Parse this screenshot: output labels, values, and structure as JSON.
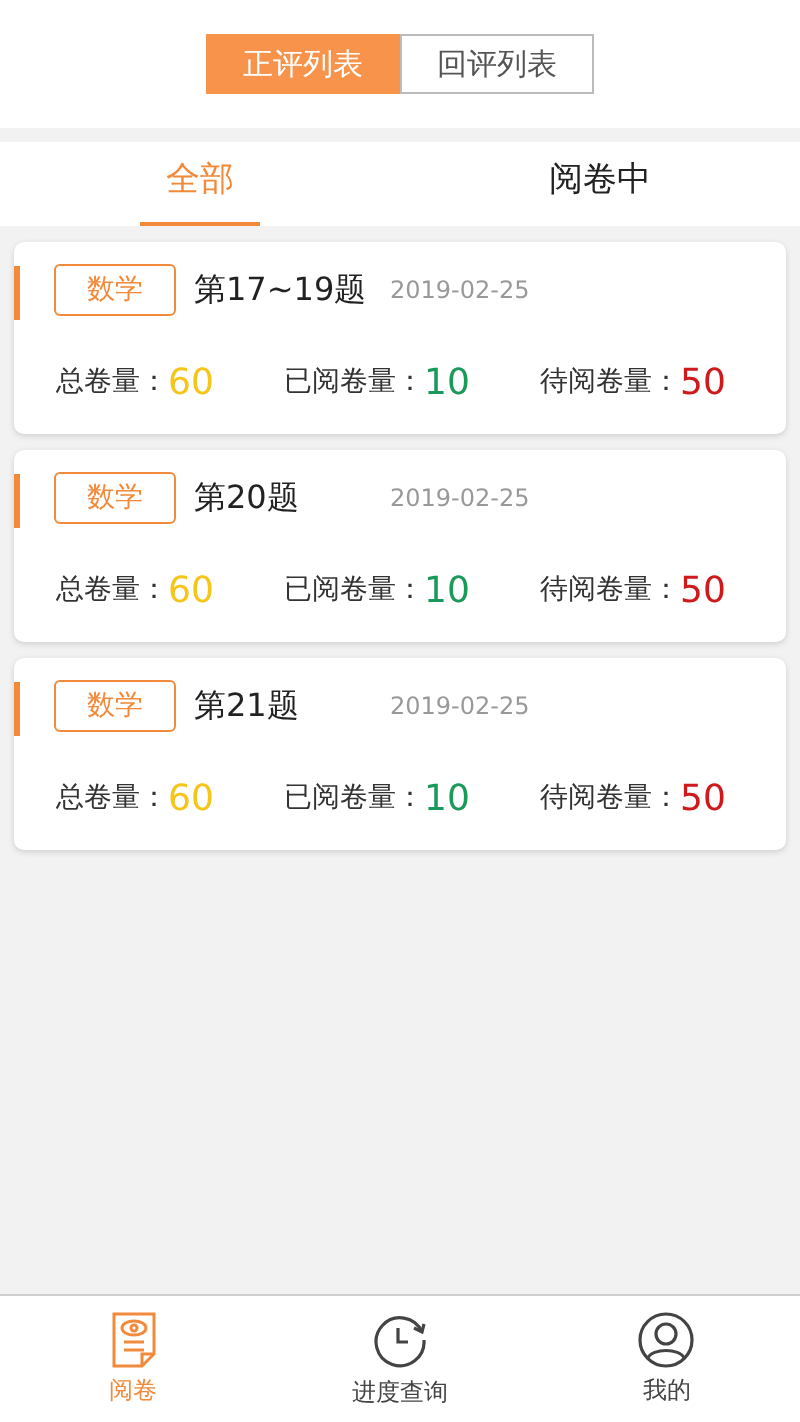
{
  "segments": [
    {
      "label": "正评列表",
      "selected": true
    },
    {
      "label": "回评列表",
      "selected": false
    }
  ],
  "tabs": [
    {
      "label": "全部",
      "selected": true
    },
    {
      "label": "阅卷中",
      "selected": false
    }
  ],
  "tasks": [
    {
      "subject": "数学",
      "title": "第17~19题",
      "date": "2019-02-25",
      "stats": [
        {
          "label": "总卷量：",
          "value": "60",
          "color": "#f5c518"
        },
        {
          "label": "已阅卷量：",
          "value": "10",
          "color": "#1a9a5a"
        },
        {
          "label": "待阅卷量：",
          "value": "50",
          "color": "#d0191b"
        }
      ]
    },
    {
      "subject": "数学",
      "title": "第20题",
      "date": "2019-02-25",
      "stats": [
        {
          "label": "总卷量：",
          "value": "60",
          "color": "#f5c518"
        },
        {
          "label": "已阅卷量：",
          "value": "10",
          "color": "#1a9a5a"
        },
        {
          "label": "待阅卷量：",
          "value": "50",
          "color": "#d0191b"
        }
      ]
    },
    {
      "subject": "数学",
      "title": "第21题",
      "date": "2019-02-25",
      "stats": [
        {
          "label": "总卷量：",
          "value": "60",
          "color": "#f5c518"
        },
        {
          "label": "已阅卷量：",
          "value": "10",
          "color": "#1a9a5a"
        },
        {
          "label": "待阅卷量：",
          "value": "50",
          "color": "#d0191b"
        }
      ]
    }
  ],
  "nav": [
    {
      "kind": "paper",
      "label": "阅卷",
      "selected": true
    },
    {
      "kind": "progress",
      "label": "进度查询",
      "selected": false
    },
    {
      "kind": "user",
      "label": "我的",
      "selected": false
    }
  ]
}
